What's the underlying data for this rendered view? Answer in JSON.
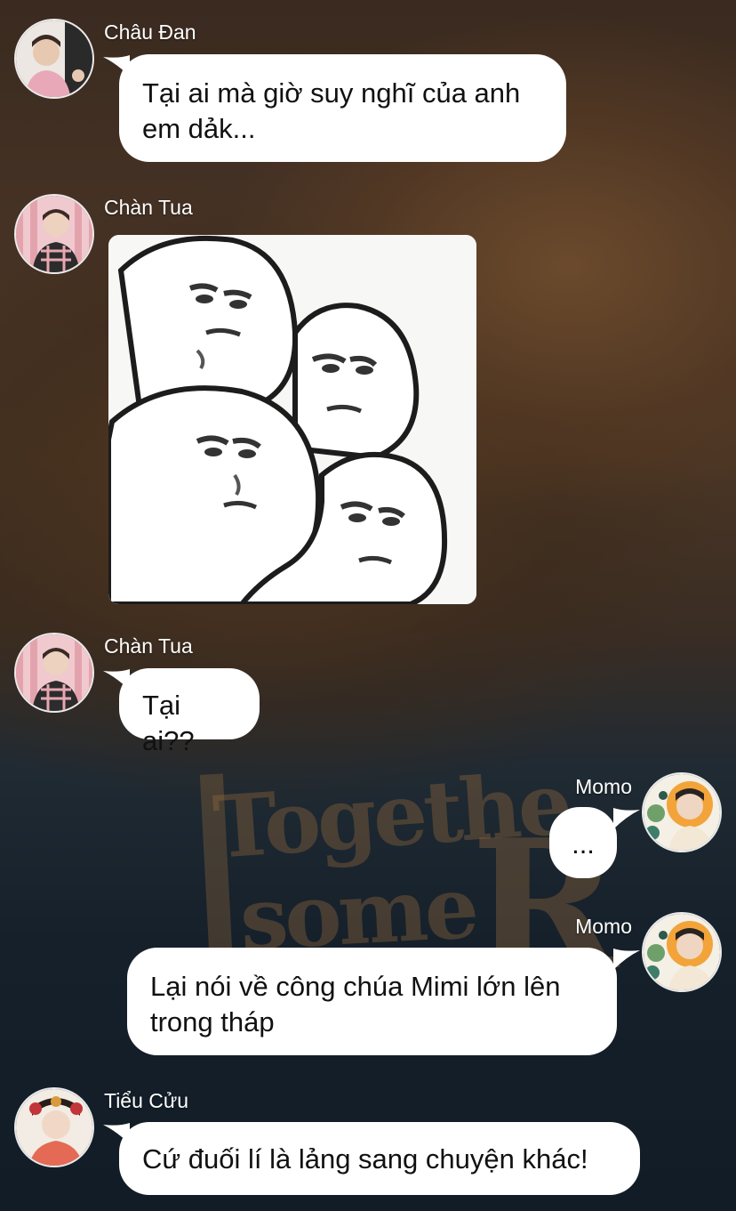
{
  "messages": [
    {
      "sender": "Châu Đan",
      "text": "Tại ai mà giờ suy nghĩ của anh em dảk..."
    },
    {
      "sender": "Chàn Tua",
      "image": "meme-faces-sticker"
    },
    {
      "sender": "Chàn Tua",
      "text": "Tại ai??"
    },
    {
      "sender": "Momo",
      "text": "..."
    },
    {
      "sender": "Momo",
      "text": "Lại nói về công chúa Mimi lớn lên trong tháp"
    },
    {
      "sender": "Tiểu Cửu",
      "text": "Cứ đuối lí là lảng sang chuyện khác!"
    }
  ],
  "colors": {
    "bubble": "#ffffff",
    "bubble_text": "#111111",
    "name_text": "#ffffff"
  }
}
